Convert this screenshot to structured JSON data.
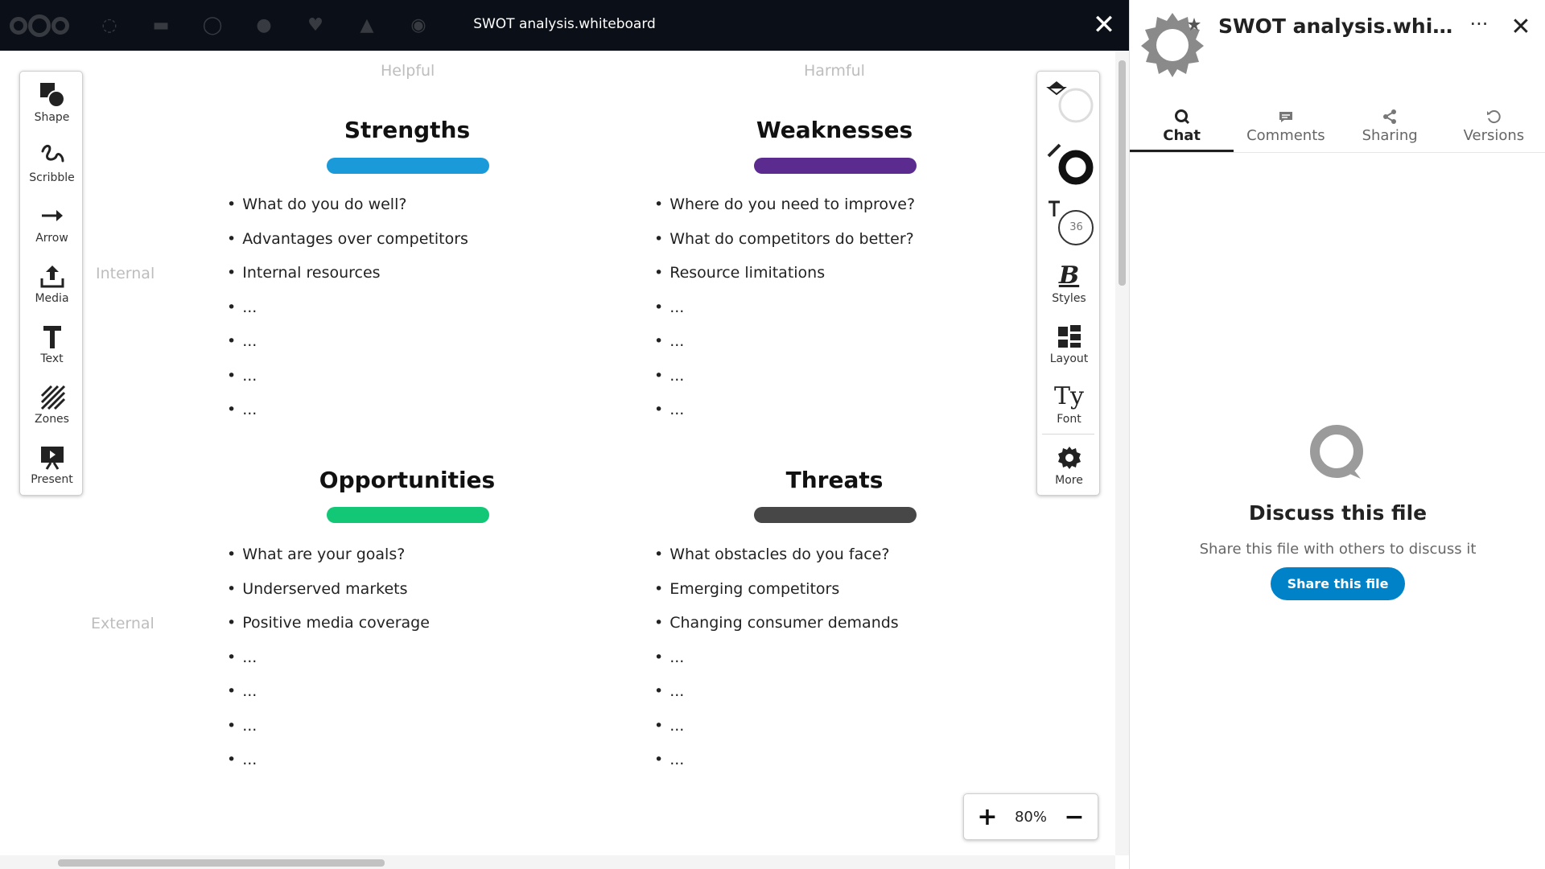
{
  "viewer": {
    "title": "SWOT analysis.whiteboard"
  },
  "canvas": {
    "columns": {
      "helpful": "Helpful",
      "harmful": "Harmful"
    },
    "rows": {
      "internal": "Internal",
      "external": "External"
    },
    "quadrants": {
      "strengths": {
        "title": "Strengths",
        "color": "#1a9ad9",
        "items": [
          "What do you do well?",
          "Advantages over competitors",
          "Internal resources",
          "...",
          "...",
          "...",
          "..."
        ]
      },
      "weaknesses": {
        "title": "Weaknesses",
        "color": "#5b2b8f",
        "items": [
          "Where do you need to improve?",
          "What do competitors do better?",
          "Resource limitations",
          "...",
          "...",
          "...",
          "..."
        ]
      },
      "opportunities": {
        "title": "Opportunities",
        "color": "#12c876",
        "items": [
          "What are your goals?",
          "Underserved markets",
          "Positive media coverage",
          "...",
          "...",
          "...",
          "..."
        ]
      },
      "threats": {
        "title": "Threats",
        "color": "#474747",
        "items": [
          "What obstacles do you face?",
          "Emerging competitors",
          "Changing consumer demands",
          "...",
          "...",
          "...",
          "..."
        ]
      }
    }
  },
  "left_toolbar": {
    "shape": "Shape",
    "scribble": "Scribble",
    "arrow": "Arrow",
    "media": "Media",
    "text": "Text",
    "zones": "Zones",
    "present": "Present"
  },
  "right_toolbar": {
    "font_size": "36",
    "styles": "Styles",
    "layout": "Layout",
    "font": "Font",
    "more": "More"
  },
  "zoom": {
    "plus": "+",
    "value": "80%",
    "minus": "−"
  },
  "sidebar": {
    "title": "SWOT analysis.whiteboard",
    "tabs": {
      "chat": "Chat",
      "comments": "Comments",
      "sharing": "Sharing",
      "versions": "Versions"
    },
    "empty": {
      "title": "Discuss this file",
      "description": "Share this file with others to discuss it",
      "button": "Share this file"
    },
    "accent_color": "#0082c9"
  }
}
